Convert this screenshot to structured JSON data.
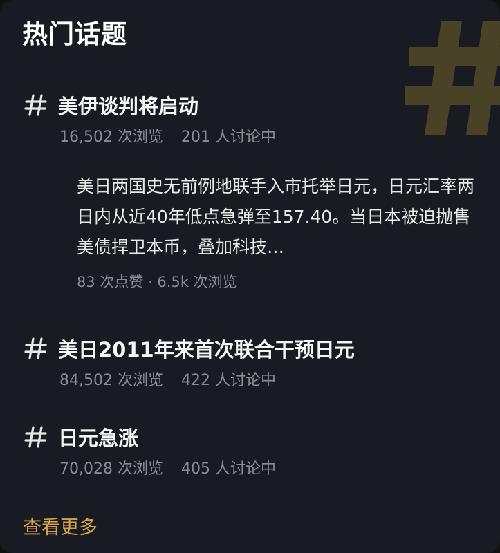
{
  "header": {
    "title": "热门话题",
    "watermark_icon": "hash-icon"
  },
  "colors": {
    "background": "#181b21",
    "text_primary": "#f5f5f5",
    "text_secondary": "#8a8d93",
    "accent": "#d8a24a",
    "watermark": "#4a4226"
  },
  "topics": [
    {
      "icon": "hash-icon",
      "title": "美伊谈判将启动",
      "views": "16,502 次浏览",
      "discussing": "201 人讨论中"
    },
    {
      "icon": "hash-icon",
      "title": "美日2011年来首次联合干预日元",
      "views": "84,502 次浏览",
      "discussing": "422 人讨论中"
    },
    {
      "icon": "hash-icon",
      "title": "日元急涨",
      "views": "70,028 次浏览",
      "discussing": "405 人讨论中"
    }
  ],
  "featured_post": {
    "text": "美日两国史无前例地联手入市托举日元，日元汇率两日内从近40年低点急弹至157.40。当日本被迫抛售美债捍卫本币，叠加科技…",
    "meta": "83 次点赞 · 6.5k 次浏览"
  },
  "footer": {
    "see_more_label": "查看更多"
  }
}
